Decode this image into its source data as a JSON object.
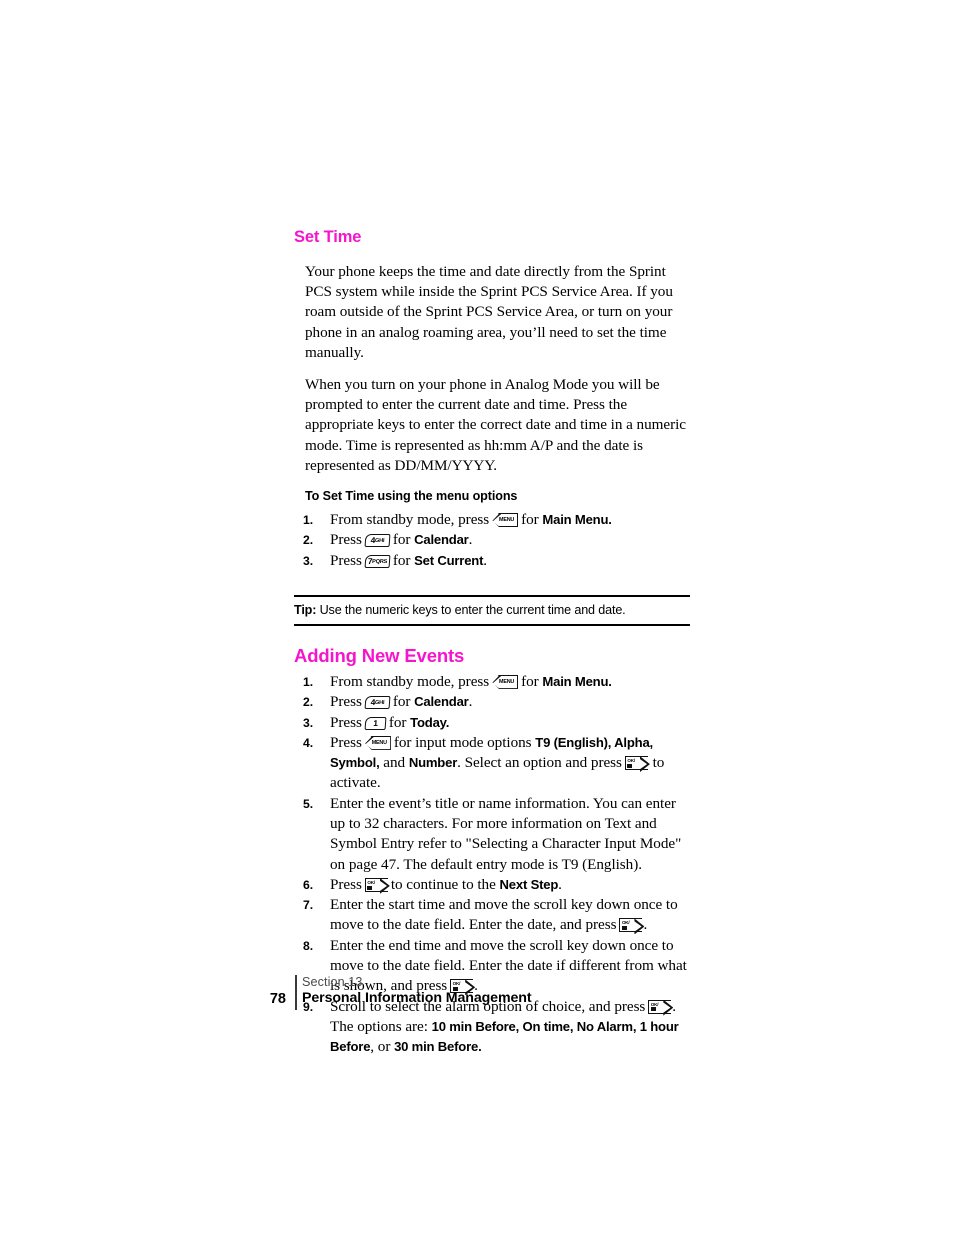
{
  "document": {
    "page_number": "78",
    "section_label": "Section 13",
    "section_name": "Personal Information Management"
  },
  "accent_color": "#f714cd",
  "sections": [
    {
      "id": "set-time",
      "heading": "Set Time",
      "paragraphs": [
        "Your phone keeps the time and date directly from the Sprint PCS system while inside the Sprint PCS Service Area. If you roam outside of the Sprint PCS Service Area, or turn on your phone in an analog roaming area, you’ll need to set the time manually.",
        "When you turn on your phone in Analog Mode you will be prompted to enter the current date and time. Press the appropriate keys to enter the correct date and time in a numeric mode. Time is represented as hh:mm A/P and the date is represented as DD/MM/YYYY."
      ],
      "subheading": "To Set Time using the menu options",
      "steps": [
        {
          "num": "1.",
          "pre": "From standby mode, press",
          "key": "menu-key",
          "key_label": "MENU",
          "mid": "for",
          "bold": "Main Menu.",
          "post": ""
        },
        {
          "num": "2.",
          "pre": "Press",
          "key": "num-key-4",
          "key_digit": "4",
          "key_letters": "GHI",
          "mid": "for",
          "bold": "Calendar",
          "post": "."
        },
        {
          "num": "3.",
          "pre": "Press",
          "key": "num-key-7",
          "key_digit": "7",
          "key_letters": "PQRS",
          "mid": "for",
          "bold": "Set Current",
          "post": "."
        }
      ]
    },
    {
      "id": "adding-new-events",
      "heading": "Adding New Events"
    }
  ],
  "tip": {
    "lead": "Tip:",
    "text": " Use the numeric keys to enter the current time and date."
  },
  "events_steps": [
    {
      "num": "1.",
      "pre": "From standby mode, press",
      "key": "menu-key",
      "mid": "for",
      "bold": "Main Menu.",
      "post": ""
    },
    {
      "num": "2.",
      "pre": "Press",
      "key": "num-key-4",
      "key_digit": "4",
      "key_letters": "GHI",
      "mid": "for",
      "bold": "Calendar",
      "post": "."
    },
    {
      "num": "3.",
      "pre": "Press",
      "key": "num-key-1",
      "key_digit": "1",
      "key_letters": "",
      "mid": "for",
      "bold": "Today.",
      "post": ""
    },
    {
      "num": "4.",
      "pre": "Press",
      "key": "menu-key",
      "mid": "for input mode options",
      "bold": "T9 (English), Alpha, Symbol,",
      "post": " and ",
      "bold2": "Number",
      "post2": ". Select an option and press",
      "key2": "ok-key",
      "post3": " to activate."
    },
    {
      "num": "5.",
      "text": "Enter the event’s title or name information. You can enter up to 32 characters. For more information on Text and Symbol Entry refer to \"Selecting a Character Input Mode\" on page 47. The default entry mode is T9 (English)."
    },
    {
      "num": "6.",
      "pre": "Press",
      "key": "ok-key",
      "mid": "to continue to the",
      "bold": "Next Step",
      "post": "."
    },
    {
      "num": "7.",
      "pre": "Enter the start time and move the scroll key down once to move to the date field. Enter the date, and press",
      "key": "ok-key",
      "post": "."
    },
    {
      "num": "8.",
      "pre": "Enter the end time and move the scroll key down once to move to the date field. Enter the date if different from what is shown, and press",
      "key": "ok-key",
      "post": "."
    },
    {
      "num": "9.",
      "pre": "Scroll to select the alarm option of choice, and press",
      "key": "ok-key",
      "post": ". The options are:",
      "bold": "10 min Before, On time, No Alarm, 1 hour Before",
      "post2": ", or ",
      "bold2": "30 min Before."
    }
  ],
  "key_glyphs": {
    "menu": "MENU",
    "ok_top": "OK/",
    "num4_digit": "4",
    "num4_letters": "GHI",
    "num7_digit": "7",
    "num7_letters": "PQRS",
    "num1_digit": "1",
    "num1_letters": ""
  }
}
